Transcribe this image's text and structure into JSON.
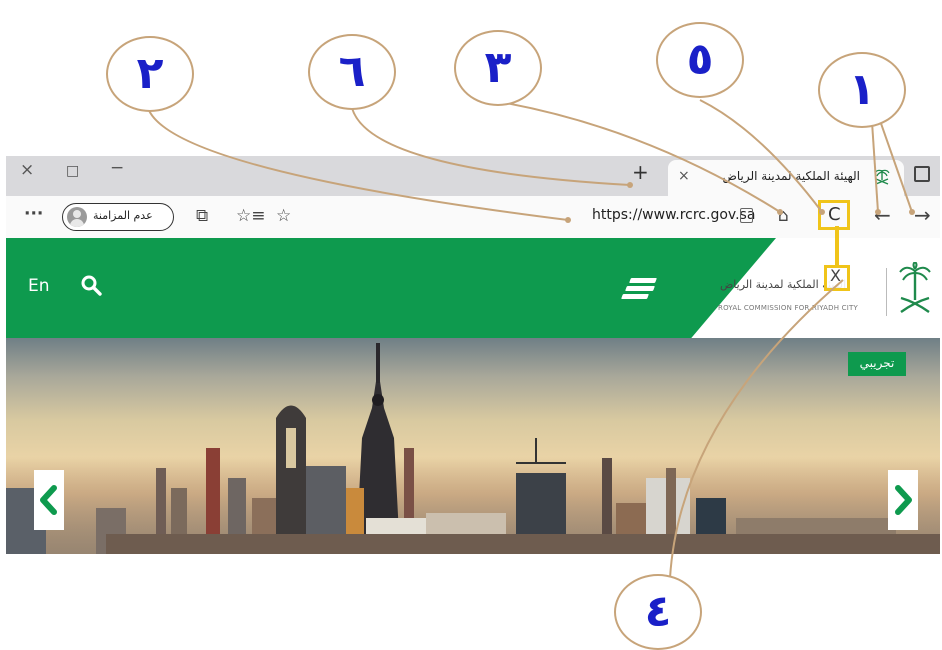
{
  "browser": {
    "tab": {
      "title": "الهيئة الملكية لمدينة الرياض",
      "close": "×"
    },
    "window_controls": {
      "close": "×",
      "maximize": "□",
      "minimize": "−"
    },
    "new_tab": "+",
    "toolbar": {
      "more": "···",
      "profile_label": "عدم المزامنة",
      "collections": "⧉",
      "favorites": "☆≡",
      "add_favorite": "☆",
      "url": "https://www.rcrc.gov.sa",
      "home": "⌂",
      "refresh": "C",
      "stop": "X",
      "back": "←",
      "forward": "→"
    }
  },
  "site": {
    "lang": "En",
    "logo_ar": "الهيئة الملكية لمدينة الرياض",
    "logo_en": "ROYAL COMMISSION FOR RIYADH CITY",
    "badge": "تجريبي",
    "prev": "‹",
    "next": "›"
  },
  "callouts": [
    {
      "id": 2,
      "label": "٢"
    },
    {
      "id": 6,
      "label": "٦"
    },
    {
      "id": 3,
      "label": "٣"
    },
    {
      "id": 5,
      "label": "٥"
    },
    {
      "id": 1,
      "label": "١"
    },
    {
      "id": 4,
      "label": "٤"
    }
  ],
  "colors": {
    "brand_green": "#0e9a4e",
    "highlight": "#f0c419",
    "callout_ring": "#c7a47a",
    "callout_text": "#1a20c8"
  }
}
